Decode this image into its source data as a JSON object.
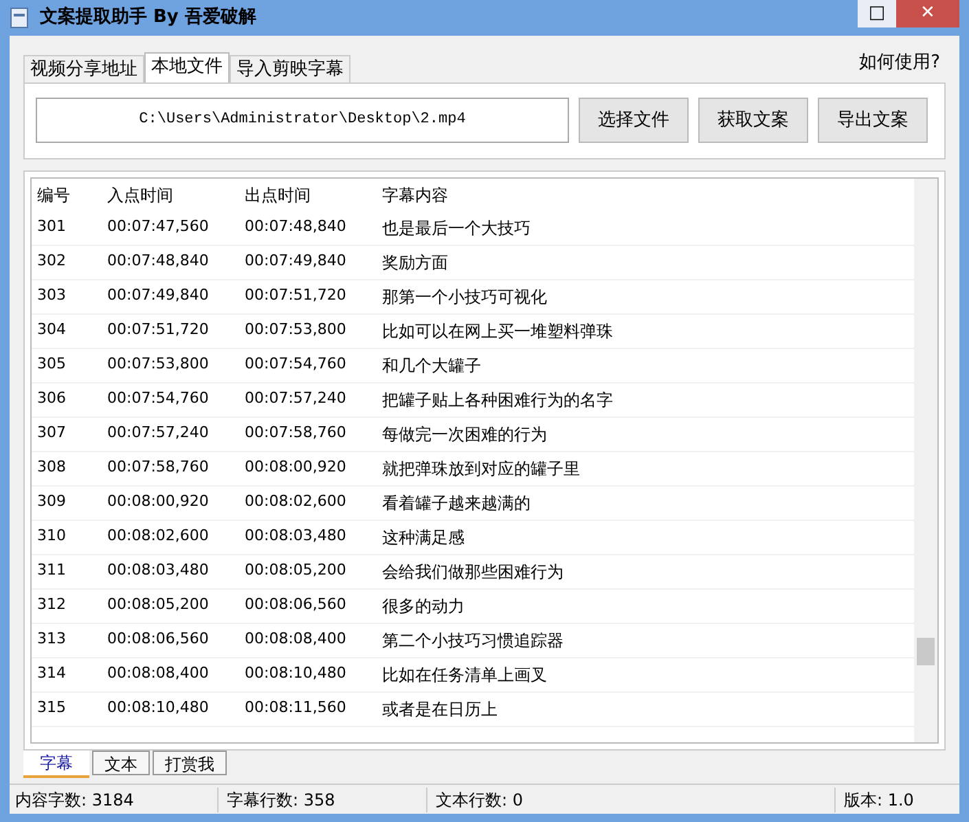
{
  "window": {
    "title": "文案提取助手 By 吾爱破解",
    "controls": [
      "□",
      "✕"
    ]
  },
  "tabs": [
    {
      "label": "视频分享地址",
      "selected": false
    },
    {
      "label": "本地文件",
      "selected": true
    },
    {
      "label": "导入剪映字幕",
      "selected": false
    }
  ],
  "help_link": "如何使用?",
  "file_path": "C:\\Users\\Administrator\\Desktop\\2.mp4",
  "buttons": [
    "选择文件",
    "获取文案",
    "导出文案"
  ],
  "table": {
    "columns": [
      "编号",
      "入点时间",
      "出点时间",
      "字幕内容"
    ],
    "rows": [
      [
        "301",
        "00:07:47,560",
        "00:07:48,840",
        "也是最后一个大技巧"
      ],
      [
        "302",
        "00:07:48,840",
        "00:07:49,840",
        "奖励方面"
      ],
      [
        "303",
        "00:07:49,840",
        "00:07:51,720",
        "那第一个小技巧可视化"
      ],
      [
        "304",
        "00:07:51,720",
        "00:07:53,800",
        "比如可以在网上买一堆塑料弹珠"
      ],
      [
        "305",
        "00:07:53,800",
        "00:07:54,760",
        "和几个大罐子"
      ],
      [
        "306",
        "00:07:54,760",
        "00:07:57,240",
        "把罐子贴上各种困难行为的名字"
      ],
      [
        "307",
        "00:07:57,240",
        "00:07:58,760",
        "每做完一次困难的行为"
      ],
      [
        "308",
        "00:07:58,760",
        "00:08:00,920",
        "就把弹珠放到对应的罐子里"
      ],
      [
        "309",
        "00:08:00,920",
        "00:08:02,600",
        "看着罐子越来越满的"
      ],
      [
        "310",
        "00:08:02,600",
        "00:08:03,480",
        "这种满足感"
      ],
      [
        "311",
        "00:08:03,480",
        "00:08:05,200",
        "会给我们做那些困难行为"
      ],
      [
        "312",
        "00:08:05,200",
        "00:08:06,560",
        "很多的动力"
      ],
      [
        "313",
        "00:08:06,560",
        "00:08:08,400",
        "第二个小技巧习惯追踪器"
      ],
      [
        "314",
        "00:08:08,400",
        "00:08:10,480",
        "比如在任务清单上画叉"
      ],
      [
        "315",
        "00:08:10,480",
        "00:08:11,560",
        "或者是在日历上"
      ]
    ]
  },
  "bottom_tabs": [
    {
      "label": "字幕",
      "selected": true
    },
    {
      "label": "文本",
      "selected": false
    },
    {
      "label": "打赏我",
      "selected": false
    }
  ],
  "status_bar": [
    "内容字数: 3184",
    "字幕行数: 358",
    "文本行数: 0",
    "版本: 1.0"
  ]
}
